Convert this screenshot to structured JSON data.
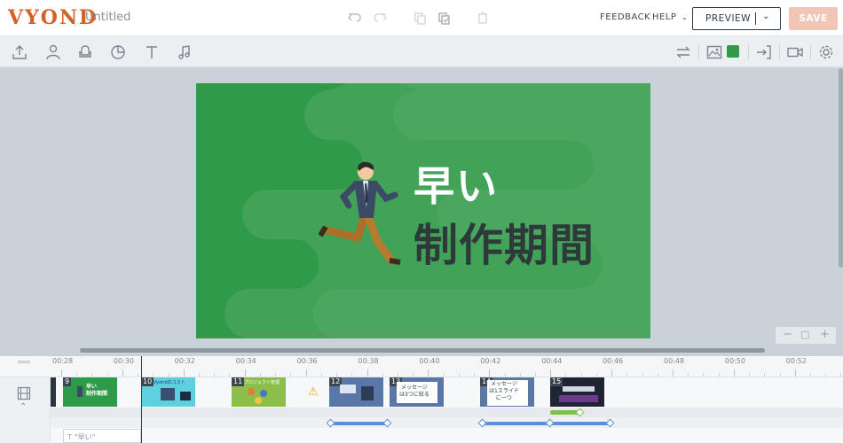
{
  "header": {
    "logo": "VYOND",
    "doc_title": "Untitled",
    "feedback": "FEEDBACK",
    "help": "HELP",
    "preview": "PREVIEW",
    "save": "SAVE",
    "icons": [
      "undo-icon",
      "redo-icon",
      "copy-icon",
      "paste-icon",
      "delete-icon"
    ]
  },
  "toolbar": {
    "left_icons": [
      "upload-icon",
      "character-icon",
      "props-icon",
      "chart-icon",
      "text-icon",
      "music-icon"
    ],
    "right_icons": [
      "swap-icon",
      "image-background-icon",
      "enter-icon",
      "camera-icon",
      "settings-icon"
    ],
    "background_color": "#2f9a48"
  },
  "canvas": {
    "title_line1": "早い",
    "title_line2": "制作期間",
    "background_color": "#2f9a48"
  },
  "timeline": {
    "ticks": [
      "00:28",
      "00:30",
      "00:32",
      "00:34",
      "00:36",
      "00:38",
      "00:40",
      "00:42",
      "00:44",
      "00:46",
      "00:48",
      "00:50",
      "00:52"
    ],
    "scenes": [
      {
        "num": "9",
        "caption": "早い\n制作期間"
      },
      {
        "num": "10",
        "caption": "Vyondのコスト"
      },
      {
        "num": "11",
        "caption": "プロジェクト管理"
      },
      {
        "num": "12",
        "caption": ""
      },
      {
        "num": "13",
        "caption": "メッセージ\nは3つに絞る"
      },
      {
        "num": "14",
        "caption": "メッセージ\nは1スライド\nに一つ"
      },
      {
        "num": "15",
        "caption": ""
      }
    ],
    "text_track_label": "\"早い\""
  }
}
